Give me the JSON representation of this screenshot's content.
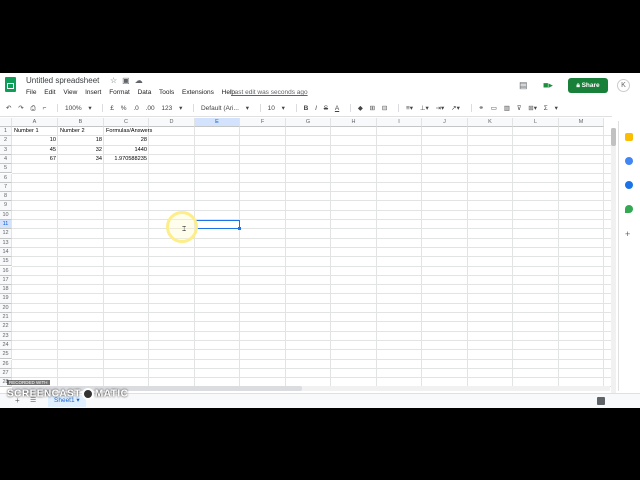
{
  "document": {
    "title": "Untitled spreadsheet",
    "last_edit": "Last edit was seconds ago"
  },
  "menu": [
    "File",
    "Edit",
    "View",
    "Insert",
    "Format",
    "Data",
    "Tools",
    "Extensions",
    "Help"
  ],
  "header_actions": {
    "share_label": "Share",
    "avatar_letter": "K"
  },
  "toolbar": {
    "zoom": "100%",
    "currency": "£",
    "percent": "%",
    "decimal_decrease": ".0",
    "decimal_increase": ".00",
    "number_format": "123",
    "font": "Default (Ari...",
    "font_size": "10",
    "bold": "B",
    "italic": "I",
    "strike": "S",
    "text_color": "A",
    "function": "Σ"
  },
  "grid": {
    "columns": [
      "A",
      "B",
      "C",
      "D",
      "E",
      "F",
      "G",
      "H",
      "I",
      "J",
      "K",
      "L",
      "M"
    ],
    "rows": [
      "1",
      "2",
      "3",
      "4",
      "5",
      "6",
      "7",
      "8",
      "9",
      "10",
      "11",
      "12",
      "13",
      "14",
      "15",
      "16",
      "17",
      "18",
      "19",
      "20",
      "21",
      "22",
      "23",
      "24",
      "25",
      "26",
      "27",
      "28"
    ],
    "cells": {
      "A1": "Number 1",
      "B1": "Number 2",
      "C1": "Formulas/Answers",
      "A2": "10",
      "B2": "18",
      "C2": "28",
      "A3": "45",
      "B3": "32",
      "C3": "1440",
      "A4": "67",
      "B4": "34",
      "C4": "1.970588235"
    },
    "selected_cell": "E11"
  },
  "sheets": {
    "active": "Sheet1"
  },
  "watermark": {
    "line1": "RECORDED WITH",
    "line2a": "SCREENCAST",
    "line2b": "MATIC"
  },
  "colors": {
    "share": "#188038",
    "selection": "#1a73e8",
    "sheets_green": "#0f9d58"
  }
}
